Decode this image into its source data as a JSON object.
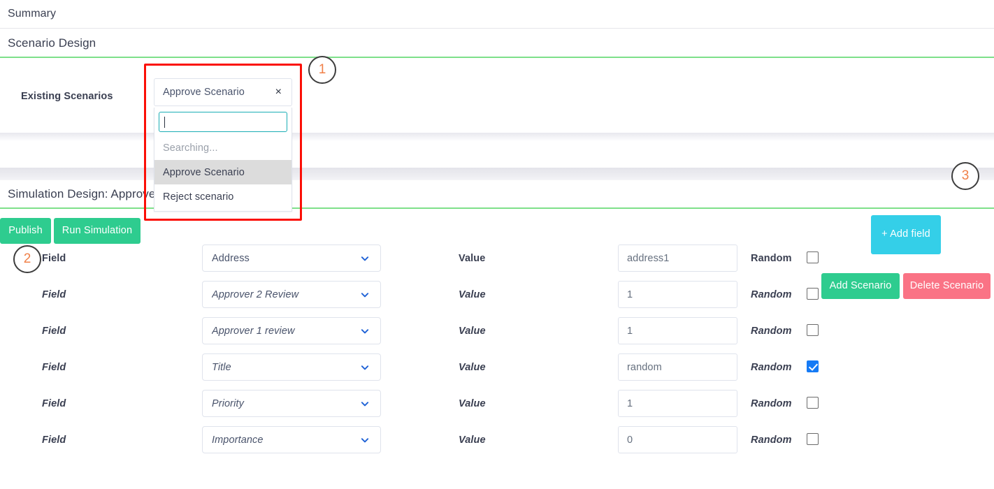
{
  "top_bar": {
    "summary_label": "Summary"
  },
  "scenario_design": {
    "heading": "Scenario Design",
    "existing_scenarios_label": "Existing Scenarios",
    "add_scenario_label": "Add Scenario",
    "delete_scenario_label": "Delete Scenario",
    "colors": {
      "add_button": "#2ecc8f",
      "delete_button": "#fa7385",
      "section_underline": "#7ee08a",
      "highlight_box": "#fb0f07"
    }
  },
  "scenario_select": {
    "selected_value": "Approve Scenario",
    "clear_glyph": "×",
    "search_value": "",
    "search_placeholder": "",
    "status_message": "Searching...",
    "options": [
      {
        "label": "Approve Scenario",
        "highlighted": true
      },
      {
        "label": "Reject scenario",
        "highlighted": false
      }
    ]
  },
  "simulation_design": {
    "heading": "Simulation Design: Approve Scenario",
    "publish_label": "Publish",
    "run_simulation_label": "Run Simulation",
    "add_field_label": "+ Add field",
    "add_field_color": "#34cfe8"
  },
  "table": {
    "field_label": "Field",
    "value_label": "Value",
    "random_label": "Random",
    "rows": [
      {
        "field": "Address",
        "value": "address1",
        "random": false
      },
      {
        "field": "Approver 2 Review",
        "value": "1",
        "random": false
      },
      {
        "field": "Approver 1 review",
        "value": "1",
        "random": false
      },
      {
        "field": "Title",
        "value": "random",
        "random": true
      },
      {
        "field": "Priority",
        "value": "1",
        "random": false
      },
      {
        "field": "Importance",
        "value": "0",
        "random": false
      }
    ]
  },
  "annotations": [
    {
      "number": "1"
    },
    {
      "number": "2"
    },
    {
      "number": "3"
    }
  ]
}
